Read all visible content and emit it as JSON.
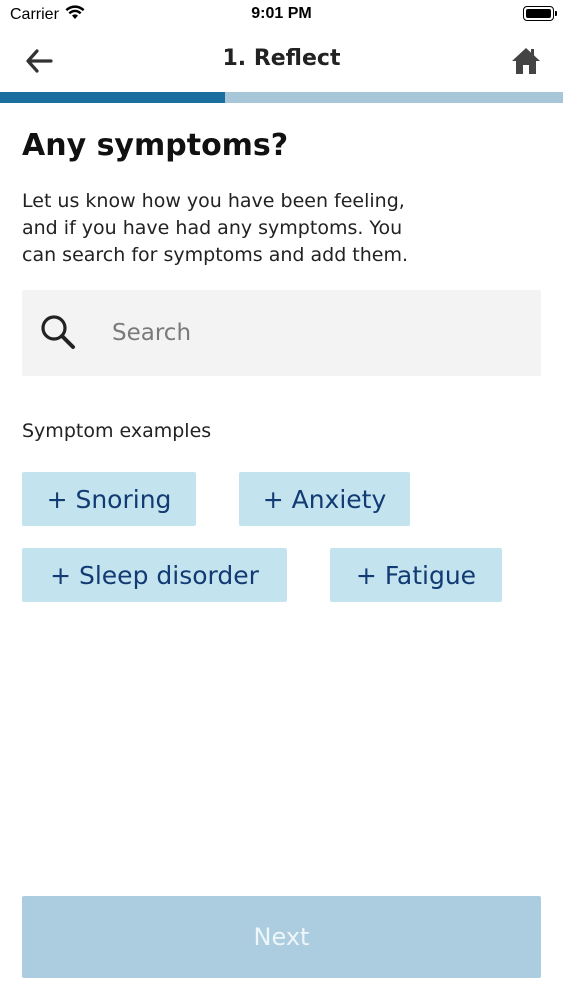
{
  "status_bar": {
    "carrier": "Carrier",
    "time": "9:01 PM",
    "wifi_icon": "wifi-icon",
    "battery_icon": "battery-icon",
    "battery_level": 1.0
  },
  "nav": {
    "back_icon": "arrow-left-icon",
    "title": "1. Reflect",
    "home_icon": "home-icon"
  },
  "progress": {
    "value": 0.4,
    "fill_color": "#1a6f9f",
    "track_color": "#a7c6d8"
  },
  "content": {
    "title": "Any symptoms?",
    "description": "Let us know how you have been feeling,\nand if you have had any symptoms. You\ncan search for symptoms and add them.",
    "search": {
      "icon": "search-icon",
      "placeholder": "Search",
      "value": ""
    },
    "examples_label": "Symptom examples",
    "chips": [
      {
        "label": "+ Snoring"
      },
      {
        "label": "+ Anxiety"
      },
      {
        "label": "+ Sleep disorder"
      },
      {
        "label": "+ Fatigue"
      }
    ],
    "chip_color": "#c3e4ef",
    "chip_text_color": "#123a73"
  },
  "footer": {
    "next_label": "Next",
    "next_color": "#acccdf"
  }
}
